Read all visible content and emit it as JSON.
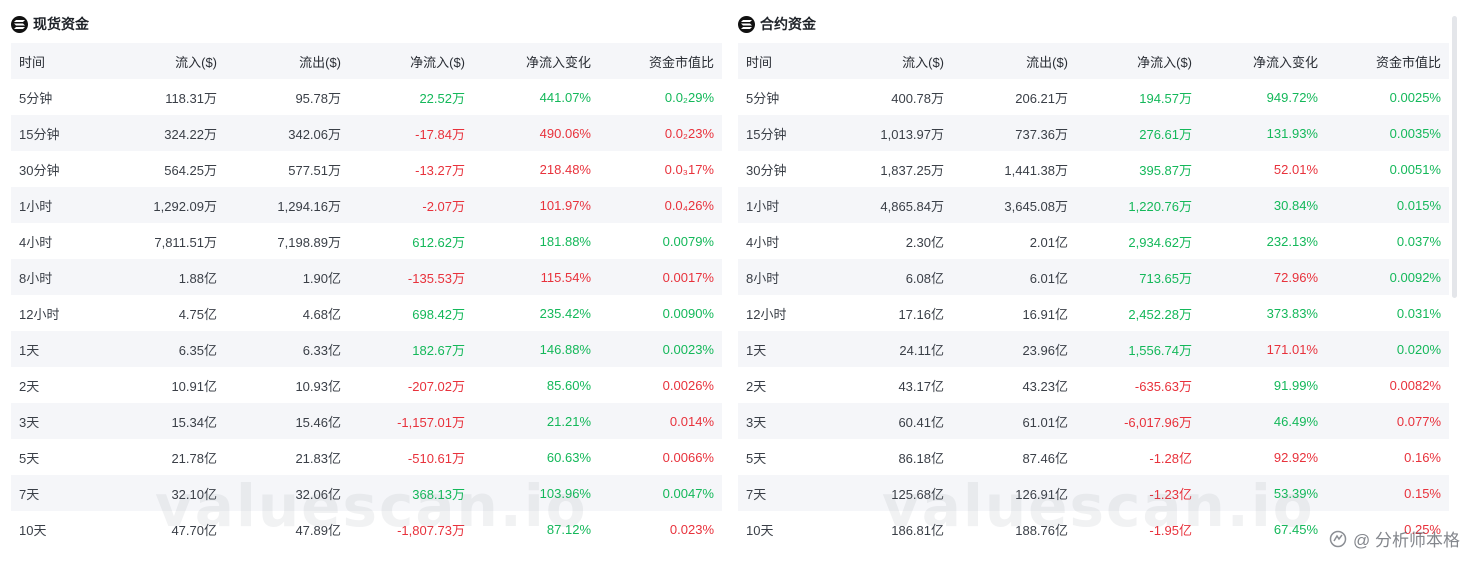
{
  "colors": {
    "positive": "#14b85a",
    "negative": "#e8323c",
    "stripe": "#f5f6f9"
  },
  "watermark": "valuescan.io",
  "source_mark": {
    "icon": "source-logo-icon",
    "text": "@ 分析师本格"
  },
  "columns": [
    "时间",
    "流入($)",
    "流出($)",
    "净流入($)",
    "净流入变化",
    "资金市值比"
  ],
  "panels": [
    {
      "id": "spot",
      "icon": "coin-logo-icon",
      "title": "现货资金",
      "rows": [
        {
          "time": "5分钟",
          "inflow": "118.31万",
          "outflow": "95.78万",
          "net": "22.52万",
          "net_color": "green",
          "change": "441.07%",
          "change_color": "green",
          "ratio": "0.0₂29%",
          "ratio_color": "green"
        },
        {
          "time": "15分钟",
          "inflow": "324.22万",
          "outflow": "342.06万",
          "net": "-17.84万",
          "net_color": "red",
          "change": "490.06%",
          "change_color": "red",
          "ratio": "0.0₂23%",
          "ratio_color": "red"
        },
        {
          "time": "30分钟",
          "inflow": "564.25万",
          "outflow": "577.51万",
          "net": "-13.27万",
          "net_color": "red",
          "change": "218.48%",
          "change_color": "red",
          "ratio": "0.0₃17%",
          "ratio_color": "red"
        },
        {
          "time": "1小时",
          "inflow": "1,292.09万",
          "outflow": "1,294.16万",
          "net": "-2.07万",
          "net_color": "red",
          "change": "101.97%",
          "change_color": "red",
          "ratio": "0.0₄26%",
          "ratio_color": "red"
        },
        {
          "time": "4小时",
          "inflow": "7,811.51万",
          "outflow": "7,198.89万",
          "net": "612.62万",
          "net_color": "green",
          "change": "181.88%",
          "change_color": "green",
          "ratio": "0.0079%",
          "ratio_color": "green"
        },
        {
          "time": "8小时",
          "inflow": "1.88亿",
          "outflow": "1.90亿",
          "net": "-135.53万",
          "net_color": "red",
          "change": "115.54%",
          "change_color": "red",
          "ratio": "0.0017%",
          "ratio_color": "red"
        },
        {
          "time": "12小时",
          "inflow": "4.75亿",
          "outflow": "4.68亿",
          "net": "698.42万",
          "net_color": "green",
          "change": "235.42%",
          "change_color": "green",
          "ratio": "0.0090%",
          "ratio_color": "green"
        },
        {
          "time": "1天",
          "inflow": "6.35亿",
          "outflow": "6.33亿",
          "net": "182.67万",
          "net_color": "green",
          "change": "146.88%",
          "change_color": "green",
          "ratio": "0.0023%",
          "ratio_color": "green"
        },
        {
          "time": "2天",
          "inflow": "10.91亿",
          "outflow": "10.93亿",
          "net": "-207.02万",
          "net_color": "red",
          "change": "85.60%",
          "change_color": "green",
          "ratio": "0.0026%",
          "ratio_color": "red"
        },
        {
          "time": "3天",
          "inflow": "15.34亿",
          "outflow": "15.46亿",
          "net": "-1,157.01万",
          "net_color": "red",
          "change": "21.21%",
          "change_color": "green",
          "ratio": "0.014%",
          "ratio_color": "red"
        },
        {
          "time": "5天",
          "inflow": "21.78亿",
          "outflow": "21.83亿",
          "net": "-510.61万",
          "net_color": "red",
          "change": "60.63%",
          "change_color": "green",
          "ratio": "0.0066%",
          "ratio_color": "red"
        },
        {
          "time": "7天",
          "inflow": "32.10亿",
          "outflow": "32.06亿",
          "net": "368.13万",
          "net_color": "green",
          "change": "103.96%",
          "change_color": "green",
          "ratio": "0.0047%",
          "ratio_color": "green"
        },
        {
          "time": "10天",
          "inflow": "47.70亿",
          "outflow": "47.89亿",
          "net": "-1,807.73万",
          "net_color": "red",
          "change": "87.12%",
          "change_color": "green",
          "ratio": "0.023%",
          "ratio_color": "red"
        }
      ]
    },
    {
      "id": "futures",
      "icon": "coin-logo-icon",
      "title": "合约资金",
      "rows": [
        {
          "time": "5分钟",
          "inflow": "400.78万",
          "outflow": "206.21万",
          "net": "194.57万",
          "net_color": "green",
          "change": "949.72%",
          "change_color": "green",
          "ratio": "0.0025%",
          "ratio_color": "green"
        },
        {
          "time": "15分钟",
          "inflow": "1,013.97万",
          "outflow": "737.36万",
          "net": "276.61万",
          "net_color": "green",
          "change": "131.93%",
          "change_color": "green",
          "ratio": "0.0035%",
          "ratio_color": "green"
        },
        {
          "time": "30分钟",
          "inflow": "1,837.25万",
          "outflow": "1,441.38万",
          "net": "395.87万",
          "net_color": "green",
          "change": "52.01%",
          "change_color": "red",
          "ratio": "0.0051%",
          "ratio_color": "green"
        },
        {
          "time": "1小时",
          "inflow": "4,865.84万",
          "outflow": "3,645.08万",
          "net": "1,220.76万",
          "net_color": "green",
          "change": "30.84%",
          "change_color": "green",
          "ratio": "0.015%",
          "ratio_color": "green"
        },
        {
          "time": "4小时",
          "inflow": "2.30亿",
          "outflow": "2.01亿",
          "net": "2,934.62万",
          "net_color": "green",
          "change": "232.13%",
          "change_color": "green",
          "ratio": "0.037%",
          "ratio_color": "green"
        },
        {
          "time": "8小时",
          "inflow": "6.08亿",
          "outflow": "6.01亿",
          "net": "713.65万",
          "net_color": "green",
          "change": "72.96%",
          "change_color": "red",
          "ratio": "0.0092%",
          "ratio_color": "green"
        },
        {
          "time": "12小时",
          "inflow": "17.16亿",
          "outflow": "16.91亿",
          "net": "2,452.28万",
          "net_color": "green",
          "change": "373.83%",
          "change_color": "green",
          "ratio": "0.031%",
          "ratio_color": "green"
        },
        {
          "time": "1天",
          "inflow": "24.11亿",
          "outflow": "23.96亿",
          "net": "1,556.74万",
          "net_color": "green",
          "change": "171.01%",
          "change_color": "red",
          "ratio": "0.020%",
          "ratio_color": "green"
        },
        {
          "time": "2天",
          "inflow": "43.17亿",
          "outflow": "43.23亿",
          "net": "-635.63万",
          "net_color": "red",
          "change": "91.99%",
          "change_color": "green",
          "ratio": "0.0082%",
          "ratio_color": "red"
        },
        {
          "time": "3天",
          "inflow": "60.41亿",
          "outflow": "61.01亿",
          "net": "-6,017.96万",
          "net_color": "red",
          "change": "46.49%",
          "change_color": "green",
          "ratio": "0.077%",
          "ratio_color": "red"
        },
        {
          "time": "5天",
          "inflow": "86.18亿",
          "outflow": "87.46亿",
          "net": "-1.28亿",
          "net_color": "red",
          "change": "92.92%",
          "change_color": "red",
          "ratio": "0.16%",
          "ratio_color": "red"
        },
        {
          "time": "7天",
          "inflow": "125.68亿",
          "outflow": "126.91亿",
          "net": "-1.23亿",
          "net_color": "red",
          "change": "53.39%",
          "change_color": "green",
          "ratio": "0.15%",
          "ratio_color": "red"
        },
        {
          "time": "10天",
          "inflow": "186.81亿",
          "outflow": "188.76亿",
          "net": "-1.95亿",
          "net_color": "red",
          "change": "67.45%",
          "change_color": "green",
          "ratio": "0.25%",
          "ratio_color": "red"
        }
      ]
    }
  ]
}
